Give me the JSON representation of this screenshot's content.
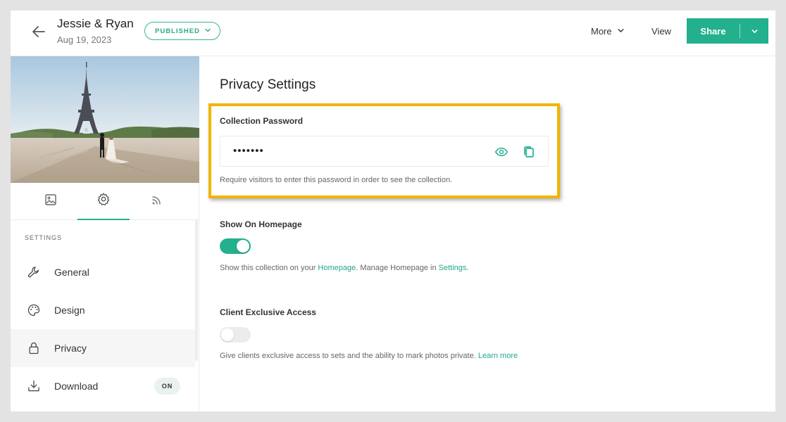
{
  "header": {
    "title": "Jessie & Ryan",
    "date": "Aug 19, 2023",
    "status": "PUBLISHED",
    "more_label": "More",
    "view_label": "View",
    "share_label": "Share"
  },
  "sidebar": {
    "tabs": [
      {
        "icon": "image-icon"
      },
      {
        "icon": "gear-icon",
        "active": true
      },
      {
        "icon": "rss-icon"
      }
    ],
    "section_label": "SETTINGS",
    "items": [
      {
        "label": "General",
        "icon": "wrench-icon"
      },
      {
        "label": "Design",
        "icon": "palette-icon"
      },
      {
        "label": "Privacy",
        "icon": "lock-icon",
        "active": true
      },
      {
        "label": "Download",
        "icon": "download-icon",
        "badge": "ON"
      }
    ]
  },
  "main": {
    "title": "Privacy Settings",
    "password": {
      "label": "Collection Password",
      "value": "•••••••",
      "help": "Require visitors to enter this password in order to see the collection."
    },
    "homepage": {
      "label": "Show On Homepage",
      "enabled": true,
      "help_prefix": "Show this collection on your ",
      "help_link1": "Homepage",
      "help_middle": ". Manage Homepage in ",
      "help_link2": "Settings",
      "help_suffix": "."
    },
    "client_access": {
      "label": "Client Exclusive Access",
      "enabled": false,
      "help": "Give clients exclusive access to sets and the ability to mark photos private.",
      "help_link": "Learn more"
    }
  },
  "colors": {
    "accent": "#22b08d",
    "highlight": "#f0b400"
  }
}
